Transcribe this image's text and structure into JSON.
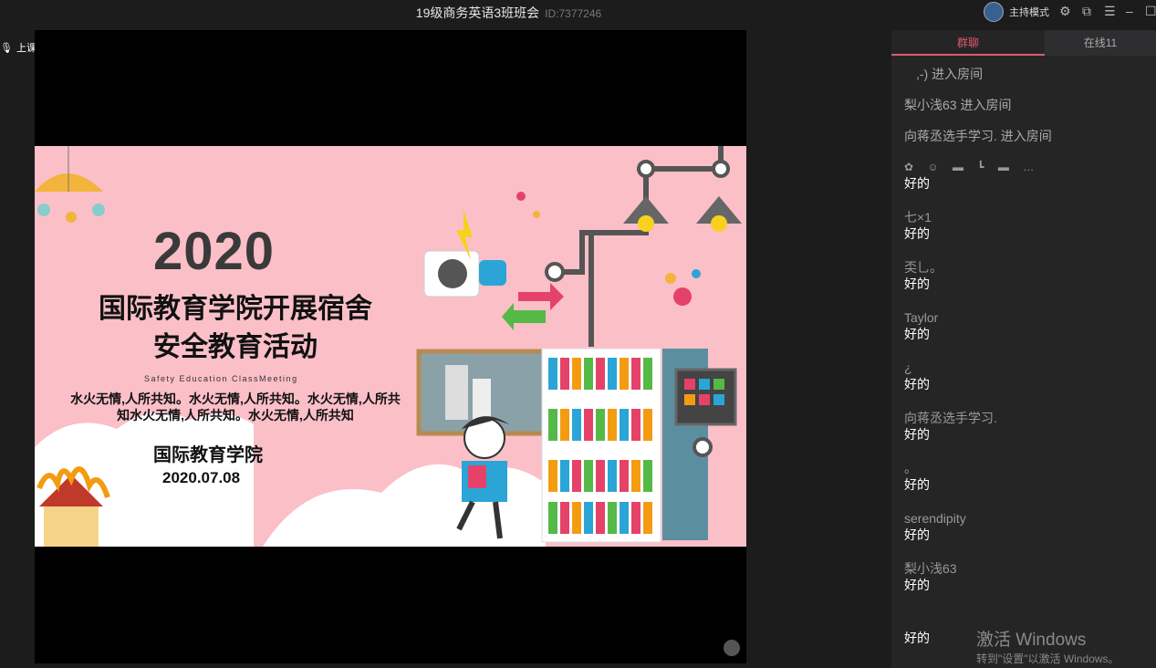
{
  "window": {
    "title": "19级商务英语3班班会",
    "room_id": "ID:7377246",
    "host_mode": "主持模式"
  },
  "status": {
    "live_label": "上课中"
  },
  "slide": {
    "year": "2020",
    "title_line1": "国际教育学院开展宿舍",
    "title_line2": "安全教育活动",
    "subtitle_en": "Safety Education ClassMeeting",
    "slogan_line1": "水火无情,人所共知。水火无情,人所共知。水火无情,人所共",
    "slogan_line2": "知水火无情,人所共知。水火无情,人所共知",
    "organizer": "国际教育学院",
    "date": "2020.07.08"
  },
  "chat": {
    "tab_group": "群聊",
    "tab_online": "在线11",
    "system_messages": [
      ",-) 进入房间",
      "梨小浅63 进入房间",
      "向蒋丞选手学习. 进入房间"
    ],
    "messages": [
      {
        "name": "",
        "text": "好的"
      },
      {
        "name": "七×1",
        "text": "好的"
      },
      {
        "name": "奀乚。",
        "text": "好的"
      },
      {
        "name": "Taylor",
        "text": "好的"
      },
      {
        "name": "¿",
        "text": "好的"
      },
      {
        "name": "向蒋丞选手学习.",
        "text": "好的"
      },
      {
        "name": "。",
        "text": "好的"
      },
      {
        "name": "serendipity",
        "text": "好的"
      },
      {
        "name": "梨小浅63",
        "text": "好的"
      },
      {
        "name": "",
        "text": "好的"
      }
    ]
  },
  "watermark": {
    "line1": "激活 Windows",
    "line2": "转到\"设置\"以激活 Windows。"
  },
  "colors": {
    "accent": "#e05a6a",
    "slide_bg": "#fbbfc8",
    "panel_bg": "#252526"
  }
}
